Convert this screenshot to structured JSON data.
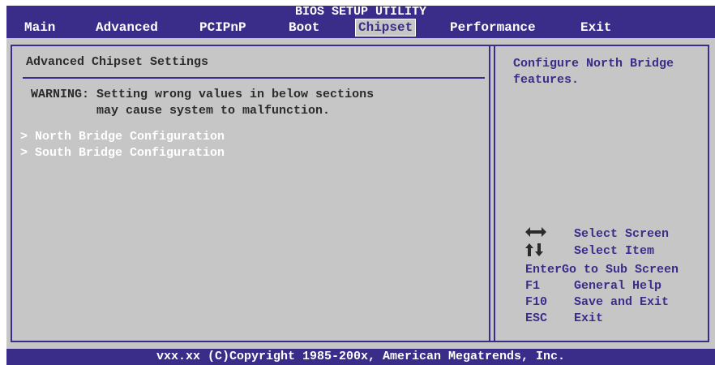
{
  "header": {
    "title": "BIOS SETUP UTILITY",
    "menu": [
      {
        "label": "Main"
      },
      {
        "label": "Advanced"
      },
      {
        "label": "PCIPnP"
      },
      {
        "label": "Boot"
      },
      {
        "label": "Chipset",
        "active": true
      },
      {
        "label": "Performance"
      },
      {
        "label": "Exit"
      }
    ]
  },
  "main": {
    "section_title": "Advanced Chipset Settings",
    "warning_line1": "WARNING: Setting wrong values in below sections",
    "warning_line2": "         may cause system to malfunction.",
    "links": [
      "> North Bridge Configuration",
      "> South Bridge Configuration"
    ]
  },
  "help": {
    "text_line1": "Configure North Bridge",
    "text_line2": "features.",
    "keys": [
      {
        "icon": "left-right-arrows-icon",
        "key": "",
        "desc": "Select Screen"
      },
      {
        "icon": "up-down-arrows-icon",
        "key": "",
        "desc": "Select Item"
      },
      {
        "key": "Enter",
        "desc": "Go to Sub Screen"
      },
      {
        "key": "F1",
        "desc": "General Help"
      },
      {
        "key": "F10",
        "desc": "Save and Exit"
      },
      {
        "key": "ESC",
        "desc": "Exit"
      }
    ]
  },
  "footer": {
    "copyright": "vxx.xx (C)Copyright 1985-200x, American Megatrends, Inc."
  },
  "colors": {
    "frame": "#3a2d8a",
    "panel": "#c6c6c6",
    "text_dark": "#2b2b2b",
    "link": "#ffffff"
  }
}
